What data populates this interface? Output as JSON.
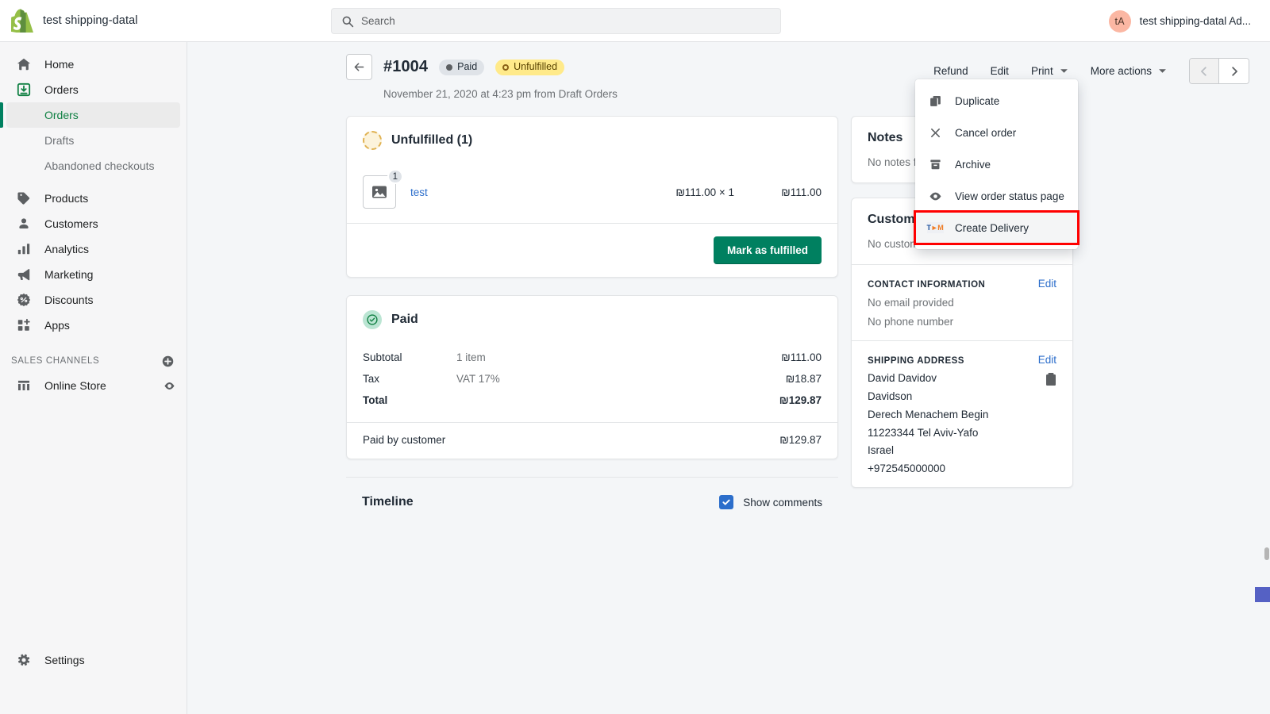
{
  "topbar": {
    "store_name": "test shipping-datal",
    "search_placeholder": "Search",
    "avatar_initials": "tA",
    "user_name": "test shipping-datal Ad..."
  },
  "sidebar": {
    "items": [
      {
        "label": "Home",
        "icon": "home-icon"
      },
      {
        "label": "Orders",
        "icon": "orders-icon"
      },
      {
        "label": "Products",
        "icon": "products-icon"
      },
      {
        "label": "Customers",
        "icon": "customers-icon"
      },
      {
        "label": "Analytics",
        "icon": "analytics-icon"
      },
      {
        "label": "Marketing",
        "icon": "marketing-icon"
      },
      {
        "label": "Discounts",
        "icon": "discounts-icon"
      },
      {
        "label": "Apps",
        "icon": "apps-icon"
      }
    ],
    "sub_items": [
      {
        "label": "Orders",
        "active": true
      },
      {
        "label": "Drafts",
        "active": false
      },
      {
        "label": "Abandoned checkouts",
        "active": false
      }
    ],
    "sales_channels_label": "SALES CHANNELS",
    "online_store_label": "Online Store",
    "settings_label": "Settings"
  },
  "header": {
    "order_number": "#1004",
    "badge_paid": "Paid",
    "badge_unfulfilled": "Unfulfilled",
    "date_line": "November 21, 2020 at 4:23 pm from Draft Orders",
    "actions": {
      "refund": "Refund",
      "edit": "Edit",
      "print": "Print",
      "more_actions": "More actions"
    }
  },
  "more_actions_menu": {
    "items": [
      {
        "label": "Duplicate",
        "icon": "duplicate-icon",
        "highlighted": false
      },
      {
        "label": "Cancel order",
        "icon": "close-icon",
        "highlighted": false
      },
      {
        "label": "Archive",
        "icon": "archive-icon",
        "highlighted": false
      },
      {
        "label": "View order status page",
        "icon": "eye-icon",
        "highlighted": false
      },
      {
        "label": "Create Delivery",
        "icon": "tdm-logo-icon",
        "highlighted": true
      }
    ],
    "highlight_color": "#ff0000"
  },
  "fulfillment_card": {
    "title": "Unfulfilled (1)",
    "line_item": {
      "name": "test",
      "quantity_badge": "1",
      "unit_price": "₪111.00 × 1",
      "line_total": "₪111.00"
    },
    "fulfill_button": "Mark as fulfilled"
  },
  "payment_card": {
    "title": "Paid",
    "rows": [
      {
        "label": "Subtotal",
        "detail": "1 item",
        "amount": "₪111.00",
        "bold": false
      },
      {
        "label": "Tax",
        "detail": "VAT 17%",
        "amount": "₪18.87",
        "bold": false
      },
      {
        "label": "Total",
        "detail": "",
        "amount": "₪129.87",
        "bold": true
      }
    ],
    "paid_by_label": "Paid by customer",
    "paid_by_amount": "₪129.87"
  },
  "timeline": {
    "title": "Timeline",
    "show_comments_label": "Show comments",
    "show_comments_checked": true
  },
  "notes_card": {
    "title": "Notes",
    "body": "No notes f"
  },
  "customer_card": {
    "title": "Custome",
    "no_customer": "No customer",
    "contact": {
      "heading": "CONTACT INFORMATION",
      "edit": "Edit",
      "email": "No email provided",
      "phone": "No phone number"
    },
    "shipping": {
      "heading": "SHIPPING ADDRESS",
      "edit": "Edit",
      "lines": [
        "David Davidov",
        "Davidson",
        "Derech Menachem Begin",
        "11223344 Tel Aviv-Yafo",
        "Israel",
        "+972545000000"
      ]
    }
  },
  "colors": {
    "brand_green": "#008060",
    "accent_blue": "#2c6ecb",
    "warn_yellow": "#ffea8a",
    "highlight_red": "#ff0000"
  }
}
